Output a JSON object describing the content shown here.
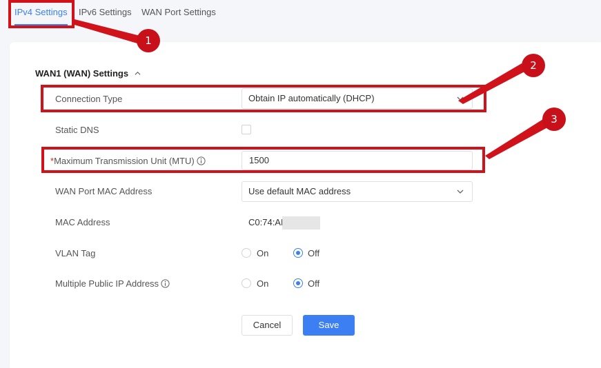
{
  "tabs": [
    {
      "label": "IPv4 Settings",
      "active": true
    },
    {
      "label": "IPv6 Settings",
      "active": false
    },
    {
      "label": "WAN Port Settings",
      "active": false
    }
  ],
  "section": {
    "title": "WAN1 (WAN) Settings",
    "expanded": true
  },
  "form": {
    "connection_type": {
      "label": "Connection Type",
      "value": "Obtain IP automatically (DHCP)"
    },
    "static_dns": {
      "label": "Static DNS",
      "checked": false
    },
    "mtu": {
      "required_mark": "*",
      "label": "Maximum Transmission Unit (MTU)",
      "value": "1500"
    },
    "wan_mac": {
      "label": "WAN Port MAC Address",
      "value": "Use default MAC address"
    },
    "mac_address": {
      "label": "MAC Address",
      "value": "C0:74:AD:"
    },
    "vlan_tag": {
      "label": "VLAN Tag",
      "on_label": "On",
      "off_label": "Off",
      "selected": "Off"
    },
    "multi_public_ip": {
      "label": "Multiple Public IP Address",
      "on_label": "On",
      "off_label": "Off",
      "selected": "Off"
    }
  },
  "buttons": {
    "cancel": "Cancel",
    "save": "Save"
  },
  "annotations": {
    "badge1": "1",
    "badge2": "2",
    "badge3": "3"
  },
  "colors": {
    "accent": "#3b7ff2",
    "annotation": "#d0121b",
    "required": "#e02020"
  },
  "icons": {
    "collapse": "chevron-up-icon",
    "dropdown": "chevron-down-icon",
    "info": "info-circle-icon"
  }
}
